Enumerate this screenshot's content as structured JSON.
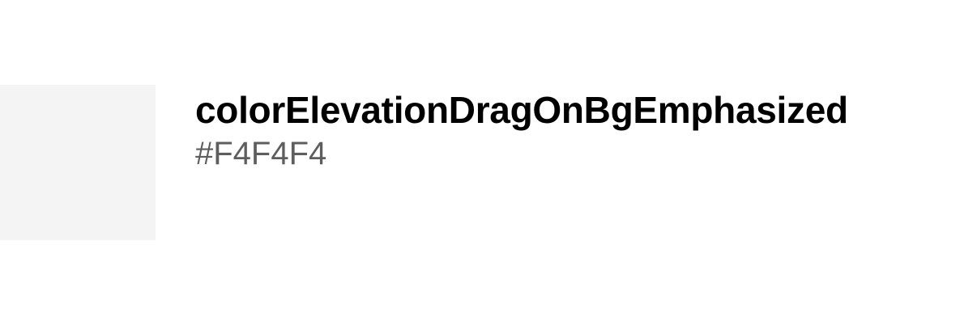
{
  "token": {
    "name": "colorElevationDragOnBgEmphasized",
    "value": "#F4F4F4",
    "swatch_color": "#F4F4F4"
  }
}
